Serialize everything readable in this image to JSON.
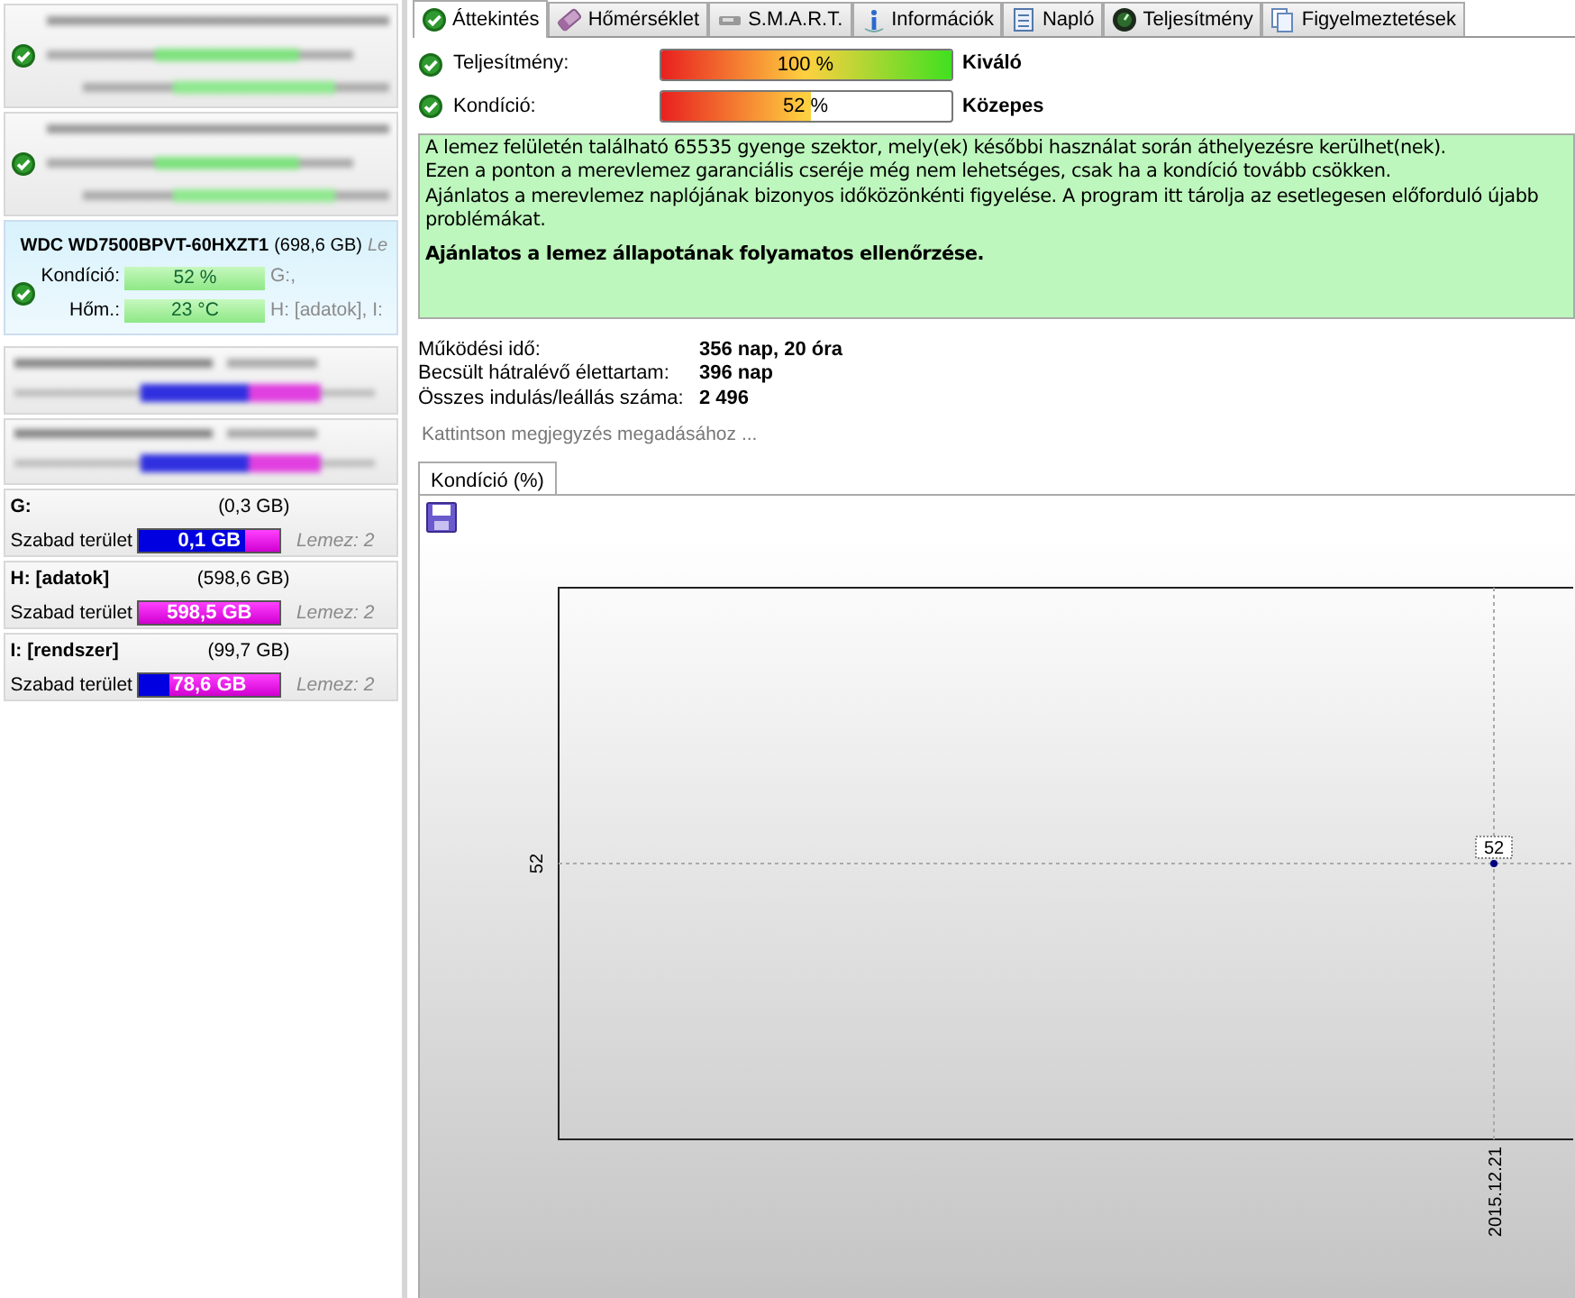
{
  "drives": [
    {
      "kind": "redacted-health",
      "selected": false
    },
    {
      "kind": "redacted-health",
      "selected": false
    },
    {
      "kind": "disk",
      "selected": true,
      "model": "WDC WD7500BPVT-60HXZT1",
      "size": "(698,6 GB)",
      "extra": "Le",
      "rows": [
        {
          "label": "Kondíció:",
          "value": "52 %",
          "partitions": "G:,"
        },
        {
          "label": "Hőm.:",
          "value": "23 °C",
          "partitions": "H: [adatok], I:"
        }
      ]
    },
    {
      "kind": "redacted-space",
      "selected": false
    },
    {
      "kind": "redacted-space",
      "selected": false
    },
    {
      "kind": "partition",
      "name": "G:",
      "size": "(0,3 GB)",
      "free_label": "Szabad terület",
      "free": "0,1 GB",
      "level": 0.25,
      "disk": "Lemez: 2"
    },
    {
      "kind": "partition",
      "name": "H: [adatok]",
      "size": "(598,6 GB)",
      "free_label": "Szabad terület",
      "free": "598,5 GB",
      "level": 1,
      "disk": "Lemez: 2"
    },
    {
      "kind": "partition",
      "name": "I: [rendszer]",
      "size": "(99,7 GB)",
      "free_label": "Szabad terület",
      "free": "78,6 GB",
      "level": 0.79,
      "disk": "Lemez: 2"
    }
  ],
  "tabs": [
    {
      "label": "Áttekintés",
      "selected": true
    },
    {
      "label": "Hőmérséklet",
      "selected": false
    },
    {
      "label": "S.M.A.R.T.",
      "selected": false
    },
    {
      "label": "Információk",
      "selected": false
    },
    {
      "label": "Napló",
      "selected": false
    },
    {
      "label": "Teljesítmény",
      "selected": false
    },
    {
      "label": "Figyelmeztetések",
      "selected": false
    }
  ],
  "status": [
    {
      "label": "Teljesítmény:",
      "value": "100 %",
      "level": 1,
      "rating": "Kiváló"
    },
    {
      "label": "Kondíció:",
      "value": "52 %",
      "level": 0.52,
      "rating": "Közepes"
    }
  ],
  "message": {
    "lines": [
      "A lemez felületén található 65535 gyenge szektor, mely(ek) későbbi használat során áthelyezésre kerülhet(nek).",
      "Ezen a ponton a merevlemez garanciális cseréje még nem lehetséges, csak ha a kondíció tovább csökken.",
      "Ajánlatos a merevlemez naplójának bizonyos időközönkénti figyelése. A program itt tárolja az esetlegesen előforduló újabb problémákat."
    ],
    "recommendation": "Ajánlatos a lemez állapotának folyamatos ellenőrzése."
  },
  "stats": [
    {
      "label": "Működési idő:",
      "value": "356 nap, 20 óra"
    },
    {
      "label": "Becsült hátralévő élettartam:",
      "value": "396 nap"
    },
    {
      "label": "Összes indulás/leállás száma:",
      "value": "2 496"
    }
  ],
  "note": {
    "placeholder": "Kattintson megjegyzés megadásához ..."
  },
  "chart_tab": {
    "label": "Kondíció  (%)",
    "selected": true
  },
  "chart": {
    "y_tick": "52",
    "x_tick": "2015.12.21",
    "point_label": "52"
  }
}
